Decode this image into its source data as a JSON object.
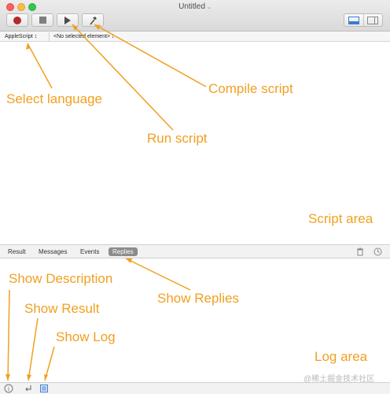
{
  "window": {
    "title": "Untitled"
  },
  "toolbar": {
    "buttons": [
      "record-button",
      "stop-button",
      "run-button",
      "compile-button"
    ]
  },
  "navbar": {
    "language": "AppleScript ↕",
    "element": "<No selected element> ↕"
  },
  "tabs": [
    "Result",
    "Messages",
    "Events",
    "Replies"
  ],
  "active_tab": "Replies",
  "annotations": {
    "select_language": "Select language",
    "compile_script": "Compile script",
    "run_script": "Run script",
    "script_area": "Script area",
    "show_description": "Show Description",
    "show_result": "Show Result",
    "show_replies": "Show Replies",
    "show_log": "Show Log",
    "log_area": "Log area"
  },
  "watermark": "@稀土掘金技术社区",
  "colors": {
    "annotation": "#f0a020",
    "record": "#b52a2a",
    "active_tab": "#8c8c8c",
    "log_icon": "#3b7bd4"
  }
}
